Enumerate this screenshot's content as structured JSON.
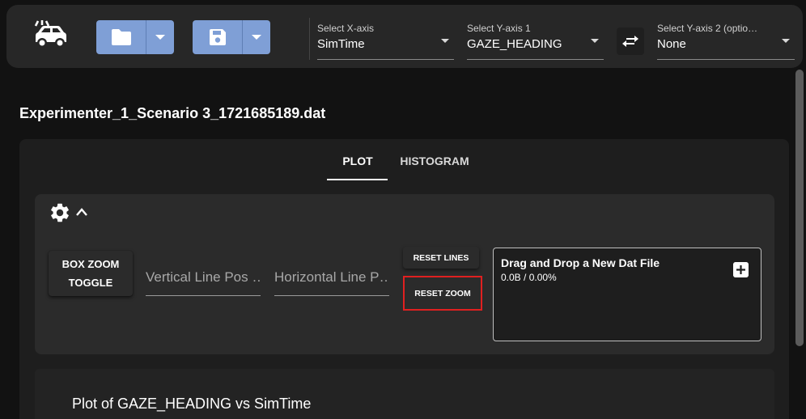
{
  "toolbar": {
    "logo_icon": "car-icon",
    "open_button_icon": "folder-icon",
    "save_button_icon": "save-icon",
    "swap_button_icon": "swap-arrows-icon",
    "button_color": "#7f9fd6"
  },
  "selectors": {
    "x_axis": {
      "label": "Select X-axis",
      "value": "SimTime"
    },
    "y_axis_1": {
      "label": "Select Y-axis 1",
      "value": "GAZE_HEADING"
    },
    "y_axis_2": {
      "label": "Select Y-axis 2 (optio…",
      "value": "None"
    }
  },
  "file": {
    "title": "Experimenter_1_Scenario 3_1721685189.dat"
  },
  "tabs": [
    {
      "label": "PLOT",
      "active": true
    },
    {
      "label": "HISTOGRAM",
      "active": false
    }
  ],
  "tools": {
    "box_zoom_line1": "BOX ZOOM",
    "box_zoom_line2": "TOGGLE",
    "vertical_line_placeholder": "Vertical Line Pos …",
    "horizontal_line_placeholder": "Horizontal Line P…",
    "reset_lines_label": "RESET LINES",
    "reset_zoom_label": "RESET ZOOM",
    "highlight_color": "#e02020"
  },
  "dropzone": {
    "title": "Drag and Drop a New Dat File",
    "stats": "0.0B / 0.00%"
  },
  "plot": {
    "title": "Plot of GAZE_HEADING vs SimTime"
  }
}
